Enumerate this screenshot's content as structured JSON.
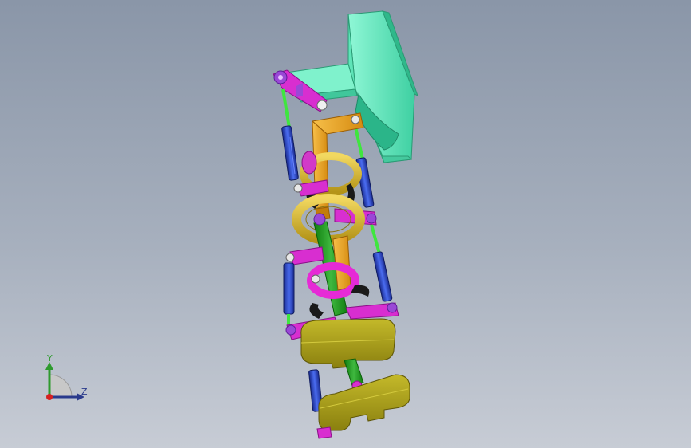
{
  "viewport": {
    "background_top": "#8a96a8",
    "background_bottom": "#c7ccd5"
  },
  "colors": {
    "bracket": "#6ef0c2",
    "bracket_dark": "#3cc79a",
    "orange": "#f2a91f",
    "orange_dark": "#c27c0a",
    "gold": "#e1c23c",
    "gold_dark": "#a88c1c",
    "magenta": "#e62ad6",
    "magenta_dark": "#a0149a",
    "purple": "#8a3fd0",
    "blue": "#2f4fd6",
    "blue_dark": "#16288a",
    "green": "#3fe63f",
    "green_dark": "#14a014",
    "olive": "#b3a81e",
    "olive_dark": "#6e660c",
    "black": "#1a1a1a"
  },
  "triad": {
    "y_label": "Y",
    "z_label": "Z",
    "y_color": "#2e9a2e",
    "z_color": "#2a3a8c",
    "origin_color": "#d62020"
  }
}
